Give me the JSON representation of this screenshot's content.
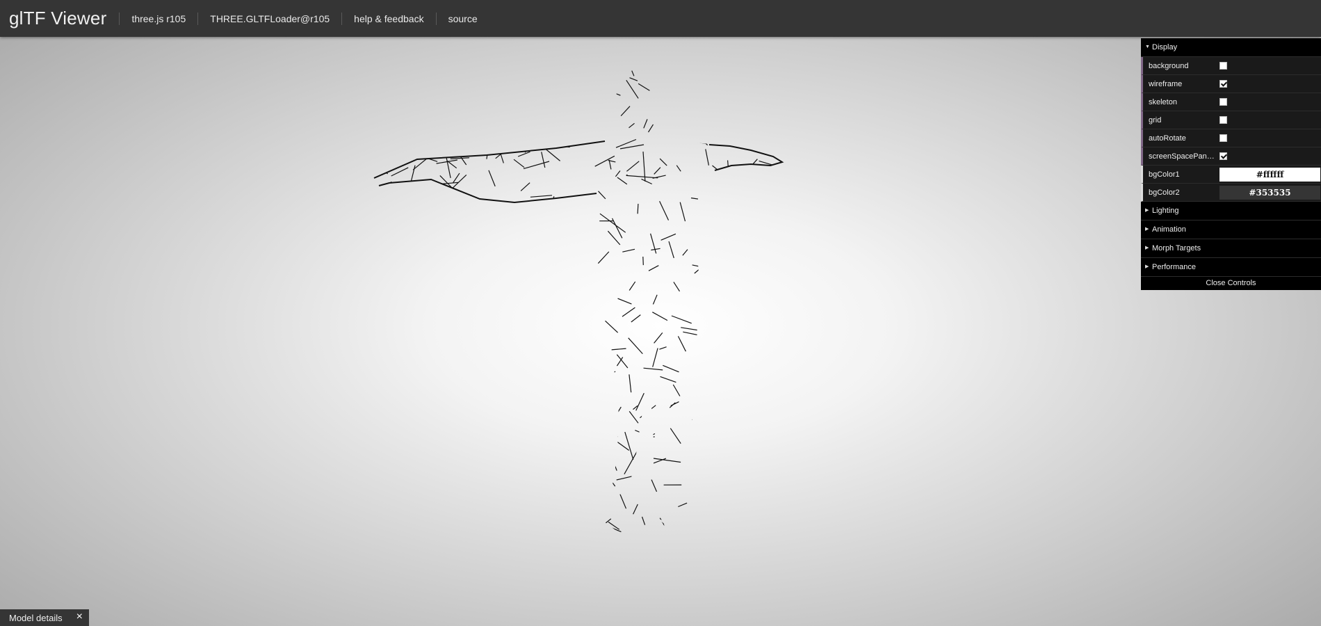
{
  "header": {
    "title": "glTF Viewer",
    "nav": [
      {
        "label": "three.js r105"
      },
      {
        "label": "THREE.GLTFLoader@r105"
      },
      {
        "label": "help & feedback"
      },
      {
        "label": "source"
      }
    ]
  },
  "gui": {
    "display": {
      "label": "Display",
      "props": [
        {
          "name": "background",
          "checked": false
        },
        {
          "name": "wireframe",
          "checked": true
        },
        {
          "name": "skeleton",
          "checked": false
        },
        {
          "name": "grid",
          "checked": false
        },
        {
          "name": "autoRotate",
          "checked": false
        },
        {
          "name": "screenSpacePan…",
          "checked": true
        }
      ],
      "colors": [
        {
          "name": "bgColor1",
          "value": "#ffffff",
          "bg": "#ffffff",
          "fg": "#111111"
        },
        {
          "name": "bgColor2",
          "value": "#353535",
          "bg": "#353535",
          "fg": "#ffffff"
        }
      ]
    },
    "folders": [
      {
        "label": "Lighting"
      },
      {
        "label": "Animation"
      },
      {
        "label": "Morph Targets"
      },
      {
        "label": "Performance"
      }
    ],
    "close_label": "Close Controls"
  },
  "model_details": {
    "label": "Model details",
    "close_glyph": "×"
  },
  "colors": {
    "header_bg": "#353535",
    "panel_bg": "#000000",
    "row_bg": "#1a1a1a",
    "boolean_accent": "#806787",
    "wire": "#111111"
  },
  "icons": {
    "folder_open": "triangle-down",
    "folder_closed": "triangle-right",
    "close": "close-x"
  }
}
